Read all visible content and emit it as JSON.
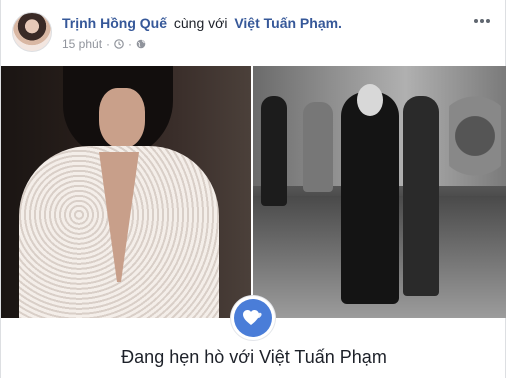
{
  "header": {
    "author_name": "Trịnh Hồng Quế",
    "with_text": "cùng với",
    "tagged_name": "Việt Tuấn Phạm.",
    "time_text": "15 phút",
    "separator": "·",
    "clock_icon": "clock-icon",
    "privacy_icon": "globe-icon",
    "more_icon": "more-horizontal-icon"
  },
  "photos": [
    {
      "icon": "photo-woman-lace-dress"
    },
    {
      "icon": "photo-men-street-bw"
    }
  ],
  "life_event": {
    "icon": "hearts-icon",
    "title": "Đang hẹn hò với Việt Tuấn Phạm"
  },
  "colors": {
    "link": "#365899",
    "meta": "#90949c",
    "badge": "#4a7dd8"
  }
}
